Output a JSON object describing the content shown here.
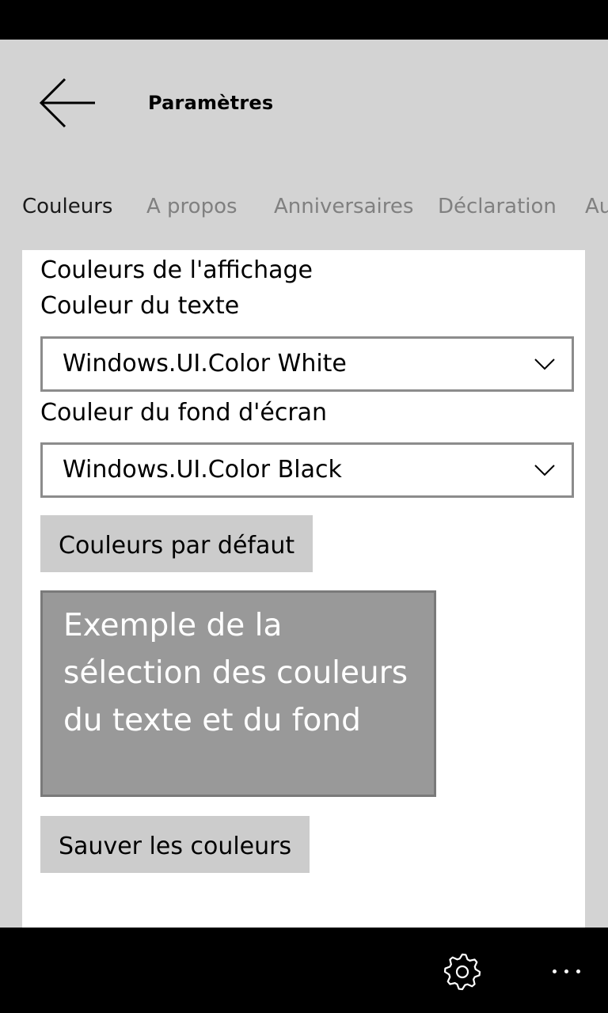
{
  "header": {
    "title": "Paramètres"
  },
  "tabs": [
    {
      "label": "Couleurs",
      "active": true
    },
    {
      "label": "A propos",
      "active": false
    },
    {
      "label": "Anniversaires",
      "active": false
    },
    {
      "label": "Déclaration",
      "active": false
    },
    {
      "label": "Au",
      "active": false
    }
  ],
  "colors_page": {
    "section_title": "Couleurs de l'affichage",
    "text_color_label": "Couleur du texte",
    "text_color_value": "Windows.UI.Color White",
    "background_color_label": "Couleur du fond d'écran",
    "background_color_value": "Windows.UI.Color Black",
    "default_button": "Couleurs par défaut",
    "preview_text": "Exemple de la sélection des couleurs du texte et du fond",
    "save_button": "Sauver les couleurs"
  },
  "appbar": {
    "settings_icon": "gear-icon",
    "more_icon": "more-icon"
  },
  "theme": {
    "background": "#d3d3d3",
    "panel": "#ffffff",
    "button": "#cccccc",
    "preview_background": "#999999",
    "preview_text": "#ffffff"
  }
}
